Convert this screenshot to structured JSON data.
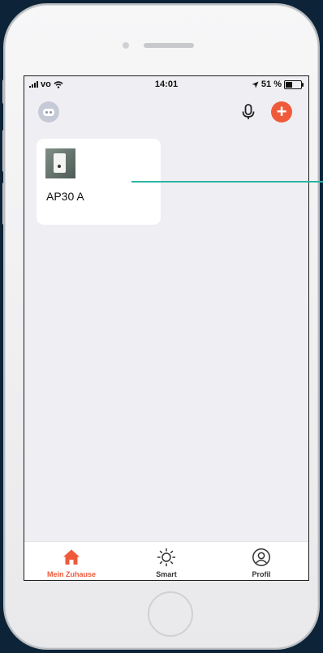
{
  "status_bar": {
    "carrier": "vo",
    "time": "14:01",
    "battery_text": "51 %",
    "battery_level": 0.51
  },
  "header": {
    "avatar_icon": "robot-avatar-icon",
    "mic_icon": "microphone-icon",
    "add_icon": "plus-icon",
    "add_symbol": "+",
    "accent_color": "#ef5b3a"
  },
  "devices": [
    {
      "name": "AP30 A",
      "icon": "air-purifier-thumbnail"
    }
  ],
  "tabs": [
    {
      "label": "Mein Zuhause",
      "icon": "home-icon",
      "active": true
    },
    {
      "label": "Smart",
      "icon": "sun-icon",
      "active": false
    },
    {
      "label": "Profil",
      "icon": "user-icon",
      "active": false
    }
  ],
  "colors": {
    "annotation_line": "#2bb3a3",
    "screen_bg": "#efeff3",
    "frame_bg": "#0d2438"
  }
}
